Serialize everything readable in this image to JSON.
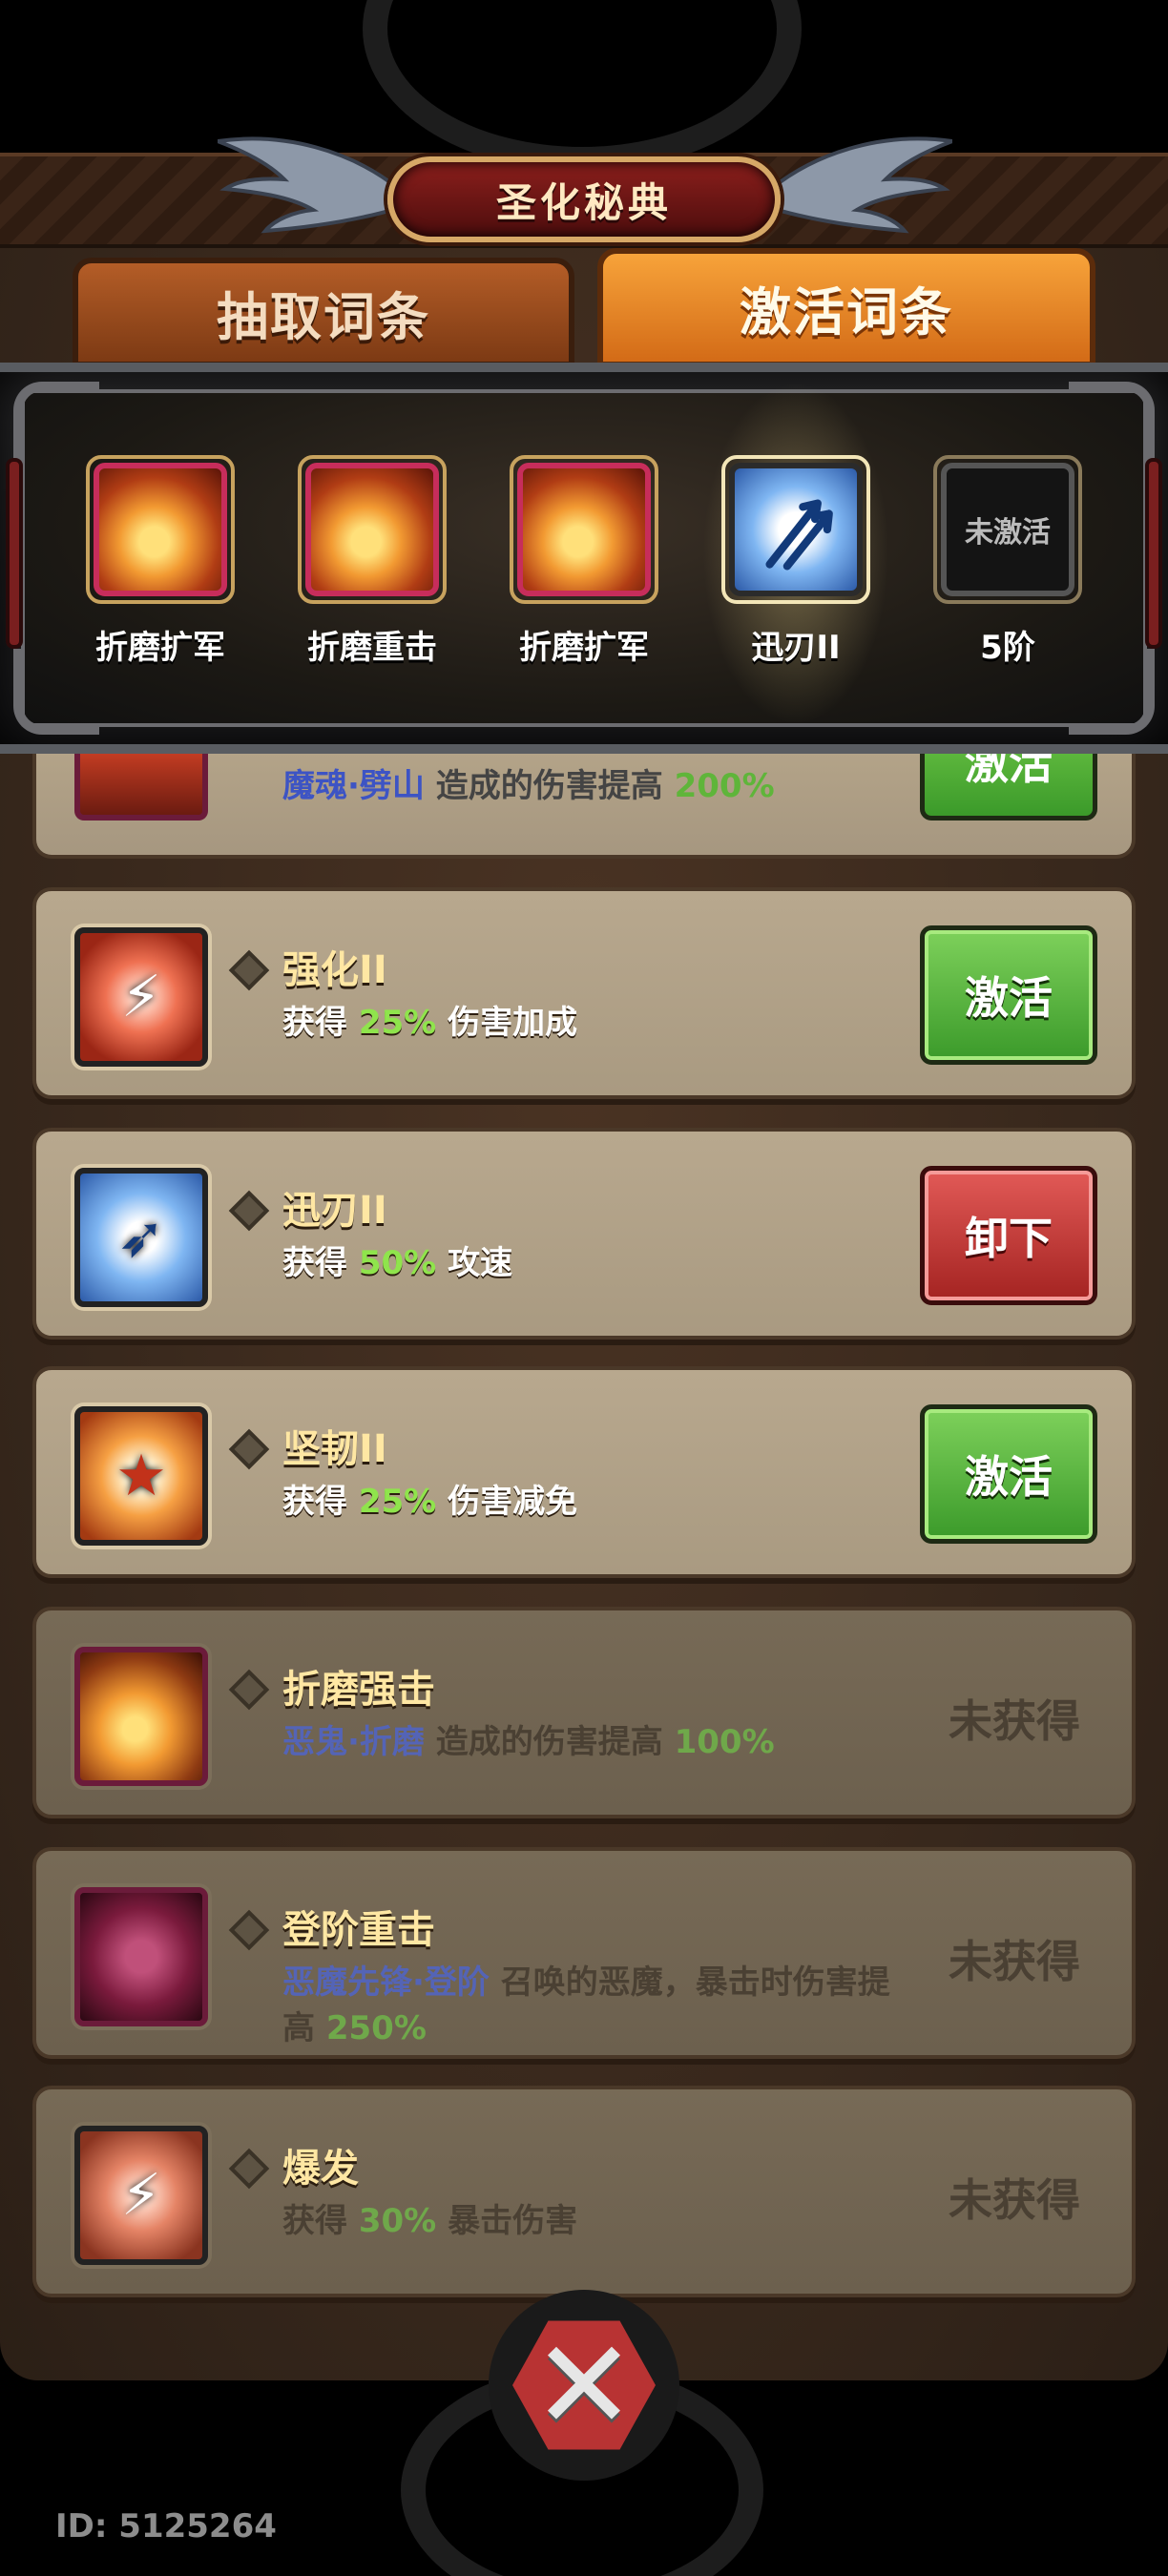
{
  "title": "圣化秘典",
  "tabs": {
    "draw": "抽取词条",
    "activate": "激活词条"
  },
  "equipped_slots": [
    {
      "label": "折磨扩军",
      "icon": "fire-swirl-icon"
    },
    {
      "label": "折磨重击",
      "icon": "fire-swirl-icon"
    },
    {
      "label": "折磨扩军",
      "icon": "fire-swirl-icon"
    },
    {
      "label": "迅刃II",
      "icon": "blue-arrows-icon"
    },
    {
      "label": "5阶",
      "icon": "locked-slot",
      "empty_text": "未激活"
    }
  ],
  "partial_card": {
    "desc_prefix": "魔魂·劈山",
    "desc_mid": " 造成的伤害提高 ",
    "desc_value": "200%",
    "button": "激活"
  },
  "cards": [
    {
      "name": "强化II",
      "desc_a": "获得 ",
      "desc_value": "25%",
      "desc_b": " 伤害加成",
      "button": "激活",
      "state": "green"
    },
    {
      "name": "迅刃II",
      "desc_a": "获得 ",
      "desc_value": "50%",
      "desc_b": " 攻速",
      "button": "卸下",
      "state": "red"
    },
    {
      "name": "坚韧II",
      "desc_a": "获得 ",
      "desc_value": "25%",
      "desc_b": " 伤害减免",
      "button": "激活",
      "state": "green"
    },
    {
      "name": "折磨强击",
      "desc_blue": "恶鬼·折磨",
      "desc_b": " 造成的伤害提高 ",
      "desc_value": "100%",
      "status": "未获得"
    },
    {
      "name": "登阶重击",
      "desc_blue": "恶魔先锋·登阶",
      "desc_b": " 召唤的恶魔，暴击时伤害提高 ",
      "desc_value": "250%",
      "status": "未获得"
    },
    {
      "name": "爆发",
      "desc_a": "获得 ",
      "desc_value": "30%",
      "desc_b": " 暴击伤害",
      "status": "未获得"
    }
  ],
  "player_id": "ID: 5125264",
  "colors": {
    "accent_green": "#8fe44c",
    "activate_button": "#4caf35",
    "unequip_button": "#c43a37",
    "title_plaque": "#7a1a18"
  }
}
